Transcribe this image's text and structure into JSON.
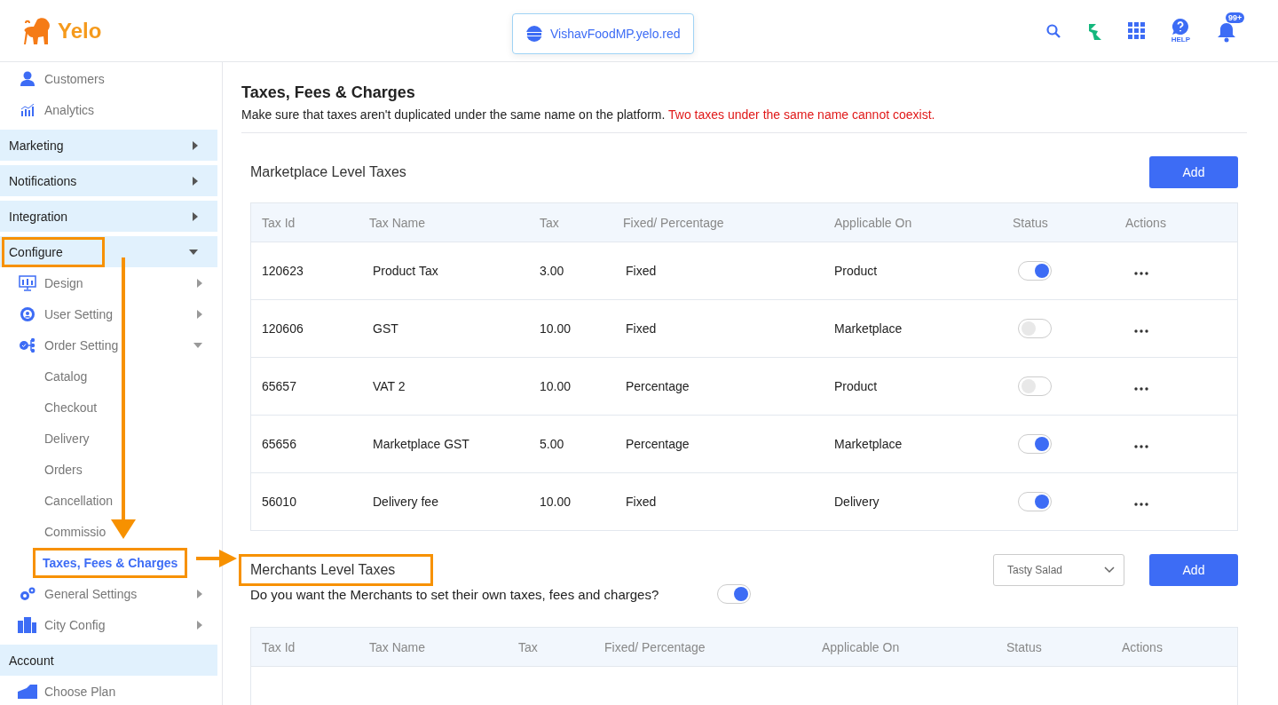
{
  "header": {
    "brand": "Yelo",
    "domain": "VishavFoodMP.yelo.red",
    "help_label": "HELP",
    "notification_badge": "99+"
  },
  "sidebar": {
    "items": [
      {
        "kind": "item",
        "label": "Customers"
      },
      {
        "kind": "item",
        "label": "Analytics"
      },
      {
        "kind": "section",
        "label": "Marketing",
        "expanded": false,
        "annotated": false
      },
      {
        "kind": "section",
        "label": "Notifications",
        "expanded": false,
        "annotated": false
      },
      {
        "kind": "section",
        "label": "Integration",
        "expanded": false,
        "annotated": false
      },
      {
        "kind": "section",
        "label": "Configure",
        "expanded": true,
        "annotated": true,
        "children": [
          {
            "kind": "item",
            "label": "Design",
            "expanded": false
          },
          {
            "kind": "item",
            "label": "User Setting",
            "expanded": false
          },
          {
            "kind": "item",
            "label": "Order Setting",
            "expanded": true,
            "children": [
              {
                "label": "Catalog",
                "selected": false,
                "annotated": false
              },
              {
                "label": "Checkout",
                "selected": false,
                "annotated": false
              },
              {
                "label": "Delivery",
                "selected": false,
                "annotated": false
              },
              {
                "label": "Orders",
                "selected": false,
                "annotated": false
              },
              {
                "label": "Cancellation",
                "selected": false,
                "annotated": false
              },
              {
                "label": "Commissio",
                "selected": false,
                "annotated": false
              },
              {
                "label": "Taxes, Fees & Charges",
                "selected": true,
                "annotated": true
              }
            ]
          },
          {
            "kind": "item",
            "label": "General Settings",
            "expanded": false
          },
          {
            "kind": "item",
            "label": "City Config",
            "expanded": false
          }
        ]
      },
      {
        "kind": "section",
        "label": "Account",
        "annotated": false,
        "children": [
          {
            "kind": "item",
            "label": "Choose Plan"
          }
        ]
      }
    ]
  },
  "page": {
    "title": "Taxes, Fees & Charges",
    "description": "Make sure that taxes aren't duplicated under the same name on the platform.",
    "warning": "Two taxes under the same name cannot coexist."
  },
  "marketplace": {
    "heading": "Marketplace Level Taxes",
    "add_button": "Add",
    "table": {
      "columns": [
        "Tax Id",
        "Tax Name",
        "Tax",
        "Fixed/ Percentage",
        "Applicable On",
        "Status",
        "Actions"
      ],
      "rows": [
        {
          "id": "120623",
          "name": "Product Tax",
          "tax": "3.00",
          "type": "Fixed",
          "applicable_on": "Product",
          "on": true
        },
        {
          "id": "120606",
          "name": "GST",
          "tax": "10.00",
          "type": "Fixed",
          "applicable_on": "Marketplace",
          "on": false
        },
        {
          "id": "65657",
          "name": "VAT 2",
          "tax": "10.00",
          "type": "Percentage",
          "applicable_on": "Product",
          "on": false
        },
        {
          "id": "65656",
          "name": "Marketplace GST",
          "tax": "5.00",
          "type": "Percentage",
          "applicable_on": "Marketplace",
          "on": true
        },
        {
          "id": "56010",
          "name": "Delivery fee",
          "tax": "10.00",
          "type": "Fixed",
          "applicable_on": "Delivery",
          "on": true
        }
      ]
    }
  },
  "merchants": {
    "heading": "Merchants Level Taxes",
    "annotated": true,
    "merchant_select": "Tasty Salad",
    "add_button": "Add",
    "question": "Do you want the Merchants to set their own taxes, fees and charges?",
    "allow_merchant_taxes": true,
    "table": {
      "columns": [
        "Tax Id",
        "Tax Name",
        "Tax",
        "Fixed/ Percentage",
        "Applicable On",
        "Status",
        "Actions"
      ]
    }
  }
}
